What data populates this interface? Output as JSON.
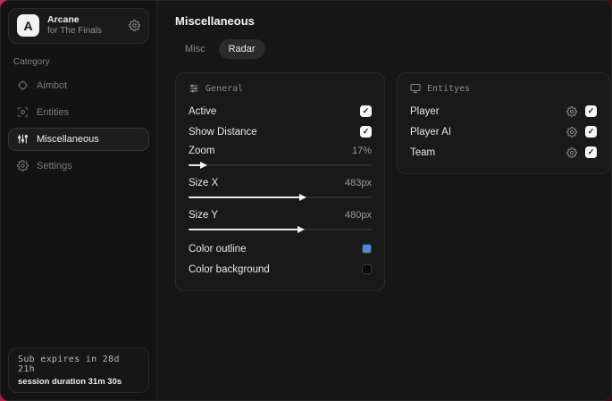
{
  "app": {
    "logo_letter": "A",
    "name": "Arcane",
    "subtitle": "for The Finals"
  },
  "sidebar": {
    "category_label": "Category",
    "items": [
      {
        "label": "Aimbot",
        "icon": "crosshair-icon",
        "selected": false
      },
      {
        "label": "Entities",
        "icon": "scan-icon",
        "selected": false
      },
      {
        "label": "Miscellaneous",
        "icon": "sliders-icon",
        "selected": true
      },
      {
        "label": "Settings",
        "icon": "gear-icon",
        "selected": false
      }
    ],
    "footer": {
      "line1": "Sub expires in 28d 21h",
      "line2": "session duration 31m 30s"
    }
  },
  "main": {
    "title": "Miscellaneous",
    "tabs": [
      {
        "label": "Misc",
        "selected": false
      },
      {
        "label": "Radar",
        "selected": true
      }
    ]
  },
  "general_panel": {
    "title": "General",
    "toggles": [
      {
        "label": "Active",
        "checked": true,
        "check_glyph": "✓"
      },
      {
        "label": "Show Distance",
        "checked": true,
        "check_glyph": "✓"
      }
    ],
    "sliders": [
      {
        "label": "Zoom",
        "value": "17%",
        "fill_percent": 7
      },
      {
        "label": "Size X",
        "value": "483px",
        "fill_percent": 61
      },
      {
        "label": "Size Y",
        "value": "480px",
        "fill_percent": 60
      }
    ],
    "colors": [
      {
        "label": "Color outline",
        "swatch": "#5089d6"
      },
      {
        "label": "Color background",
        "swatch": "#0a0a0a"
      }
    ]
  },
  "entities_panel": {
    "title": "Entityes",
    "rows": [
      {
        "label": "Player",
        "checked": true,
        "check_glyph": "✓"
      },
      {
        "label": "Player AI",
        "checked": true,
        "check_glyph": "✓"
      },
      {
        "label": "Team",
        "checked": true,
        "check_glyph": "✓"
      }
    ]
  },
  "theme": {
    "accent_red": "#d42449",
    "checkbox_bg": "#f5f5f5",
    "slider_fill": "#e9e9e9"
  }
}
